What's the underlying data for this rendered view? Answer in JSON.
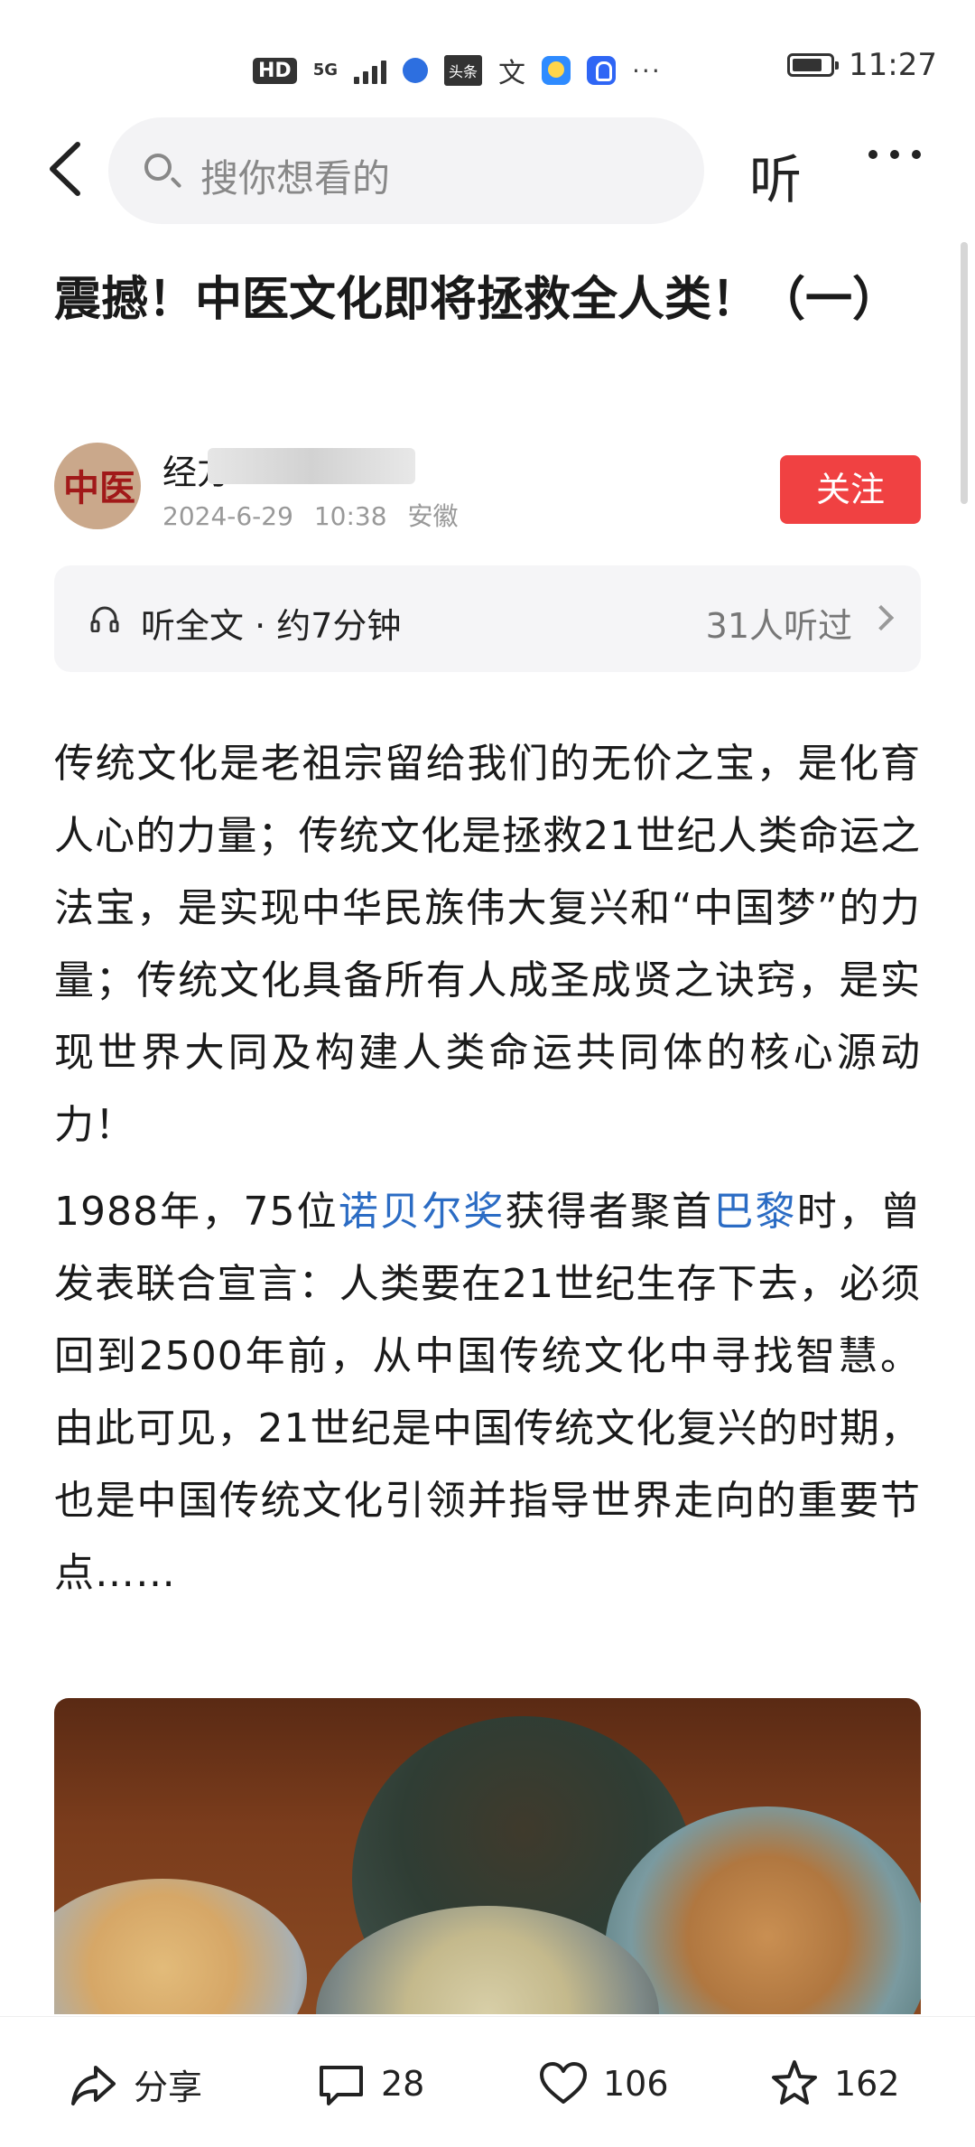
{
  "status_bar": {
    "hd": "HD",
    "network": "5G",
    "toutiao_icon_text": "头条",
    "time": "11:27"
  },
  "nav": {
    "search_placeholder": "搜你想看的",
    "listen_label": "听"
  },
  "article": {
    "title": "震撼！中医文化即将拯救全人类！（一）",
    "author": {
      "name_visible": "经方",
      "avatar_text": "中医",
      "date": "2024-6-29",
      "time": "10:38",
      "location": "安徽",
      "follow_label": "关注"
    },
    "listen_bar": {
      "label": "听全文 · 约7分钟",
      "count": "31人听过"
    },
    "paragraph1": "传统文化是老祖宗留给我们的无价之宝，是化育人心的力量；传统文化是拯救21世纪人类命运之法宝，是实现中华民族伟大复兴和“中国梦”的力量；传统文化具备所有人成圣成贤之诀窍，是实现世界大同及构建人类命运共同体的核心源动力！",
    "paragraph2": {
      "part1": "1988年，75位",
      "link1": "诺贝尔奖",
      "part2": "获得者聚首",
      "link2": "巴黎",
      "part3": "时，曾发表联合宣言：人类要在21世纪生存下去，必须回到2500年前，从中国传统文化中寻找智慧。由此可见，21世纪是中国传统文化复兴的时期，也是中国传统文化引领并指导世界走向的重要节点……"
    }
  },
  "bottom_bar": {
    "share_label": "分享",
    "comments": "28",
    "likes": "106",
    "favorites": "162"
  },
  "colors": {
    "follow_button": "#f04142",
    "link": "#2b6cc4"
  }
}
